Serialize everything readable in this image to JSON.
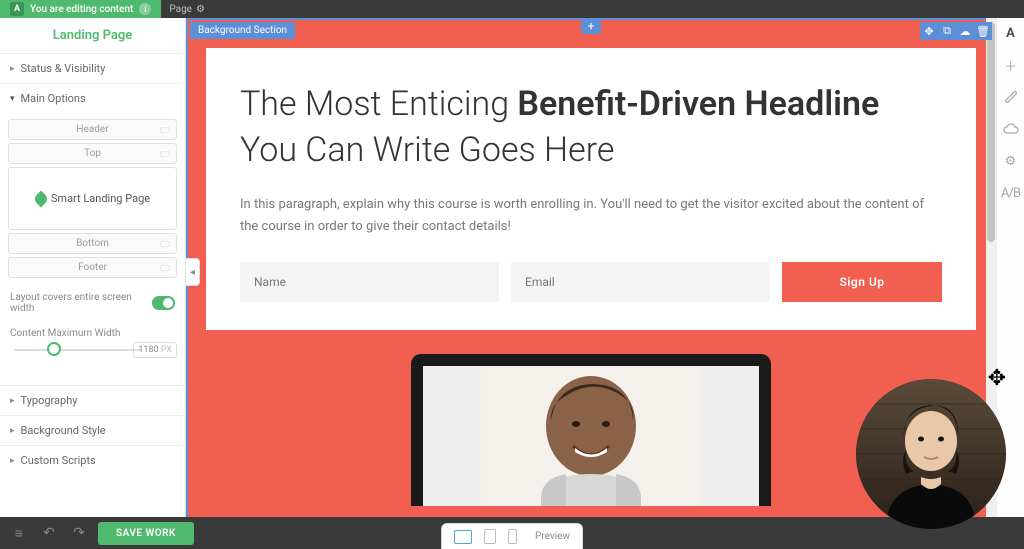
{
  "topbar": {
    "badge": "A",
    "editing_label": "You are editing content",
    "page_label": "Page"
  },
  "sidebar": {
    "title": "Landing Page",
    "panel_status": "Status & Visibility",
    "panel_main": "Main Options",
    "layout": {
      "header": "Header",
      "top": "Top",
      "center": "Smart Landing Page",
      "bottom": "Bottom",
      "footer": "Footer"
    },
    "toggle_label": "Layout covers entire screen width",
    "width_label": "Content Maximum Width",
    "width_value": "1180",
    "width_unit": "PX",
    "panel_typography": "Typography",
    "panel_bgstyle": "Background Style",
    "panel_scripts": "Custom Scripts"
  },
  "bottombar": {
    "save": "SAVE WORK"
  },
  "canvas": {
    "section_label": "Background Section",
    "headline_light1": "The Most Enticing ",
    "headline_bold": "Benefit-Driven Headline",
    "headline_light2": " You Can Write Goes Here",
    "paragraph": "In this paragraph, explain why this course is worth enrolling in. You'll need to get the visitor excited about the content of the course in order to give their contact details!",
    "name_placeholder": "Name",
    "email_placeholder": "Email",
    "signup": "Sign Up"
  },
  "footer": {
    "preview": "Preview"
  },
  "rail": {
    "ab": "A/B"
  }
}
